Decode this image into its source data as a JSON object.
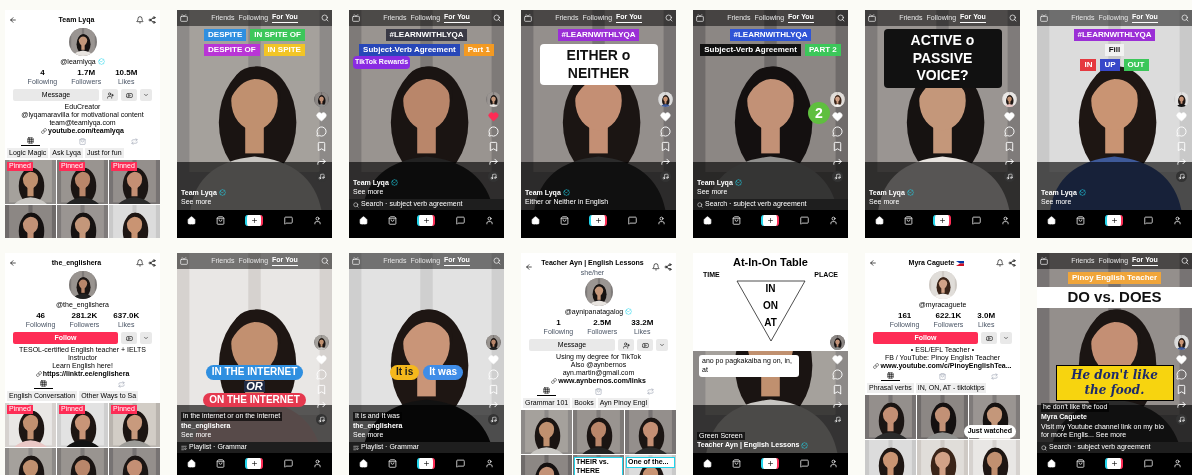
{
  "screens": [
    {
      "kind": "profile",
      "title": "Team Lyqa",
      "handle": "@learnlyqa",
      "verified": true,
      "stats": [
        {
          "value": "4",
          "label": "Following"
        },
        {
          "value": "1.7M",
          "label": "Followers"
        },
        {
          "value": "10.5M",
          "label": "Likes"
        }
      ],
      "button": {
        "label": "Message",
        "kind": "message"
      },
      "friend_button": true,
      "bio": [
        "EduCreator",
        "@lyqamaravilla for motivational content",
        "team@teamlyqa.com"
      ],
      "link": "youtube.com/teamlyqa",
      "content_tabs": [
        {
          "kind": "videos",
          "selected": true
        },
        {
          "kind": "shop",
          "selected": false
        },
        {
          "kind": "reposts",
          "selected": false
        }
      ],
      "playlists": [
        "Logic Magic",
        "Ask Lyqa",
        "Just for fun"
      ],
      "thumbnails": [
        {
          "kind": "picture",
          "badge": "Pinned"
        },
        {
          "kind": "picture",
          "badge": "Pinned"
        },
        {
          "kind": "picture",
          "badge": "Pinned"
        },
        {
          "kind": "picture"
        },
        {
          "kind": "picture"
        },
        {
          "kind": "picture"
        }
      ]
    },
    {
      "kind": "video",
      "tabs": [
        {
          "label": "Friends",
          "selected": false
        },
        {
          "label": "Following",
          "selected": false
        },
        {
          "label": "For You",
          "selected": true
        }
      ],
      "captions": [
        [
          {
            "kind": "tag",
            "text": "DESPITE",
            "color": "#2f8fe0"
          },
          {
            "kind": "tag",
            "text": "IN SPITE OF",
            "color": "#3cc75a"
          }
        ],
        [
          {
            "kind": "tag",
            "text": "DESPITE OF",
            "color": "#b935d6"
          },
          {
            "kind": "tag",
            "text": "IN SPITE",
            "color": "#f2c526"
          }
        ]
      ],
      "liked": false,
      "author": "Team Lyqa",
      "verified": true,
      "description": "See more"
    },
    {
      "kind": "video",
      "tabs": [
        {
          "label": "Friends",
          "selected": false
        },
        {
          "label": "Following",
          "selected": false
        },
        {
          "label": "For You",
          "selected": true
        }
      ],
      "captions": [
        [
          {
            "kind": "hashtag",
            "text": "#LEARNWITHLYQA",
            "color": "#3a3a46"
          }
        ],
        [
          {
            "kind": "tag",
            "text": "Subject-Verb Agreement",
            "color": "#2747b8"
          },
          {
            "kind": "tag",
            "text": "Part 1",
            "color": "#f39a23"
          }
        ]
      ],
      "badge": "TikTok Rewards",
      "liked": true,
      "author": "Team Lyqa",
      "verified": true,
      "description": "See more",
      "search": "Search · subject verb agreement"
    },
    {
      "kind": "video",
      "tabs": [
        {
          "label": "Friends",
          "selected": false
        },
        {
          "label": "Following",
          "selected": false
        },
        {
          "label": "For You",
          "selected": true
        }
      ],
      "captions": [
        [
          {
            "kind": "hashtag",
            "text": "#LEARNWITHLYQA",
            "color": "#9b2fd6"
          }
        ],
        [
          {
            "kind": "title",
            "text": "EITHER o NEITHER",
            "color": "#ffffff"
          }
        ]
      ],
      "liked": false,
      "author": "Team Lyqa",
      "verified": true,
      "description": "Either or Neither in English"
    },
    {
      "kind": "video",
      "tabs": [
        {
          "label": "Friends",
          "selected": false
        },
        {
          "label": "Following",
          "selected": false
        },
        {
          "label": "For You",
          "selected": true
        }
      ],
      "captions": [
        [
          {
            "kind": "hashtag",
            "text": "#LEARNWITHLYQA",
            "color": "#2f55d6"
          }
        ],
        [
          {
            "kind": "tag",
            "text": "Subject-Verb Agreement",
            "color": "#111111"
          },
          {
            "kind": "tag",
            "text": "PART 2",
            "color": "#3cc75a"
          }
        ]
      ],
      "sticker": "2",
      "liked": false,
      "author": "Team Lyqa",
      "verified": true,
      "description": "See more",
      "search": "Search · subject verb agreement"
    },
    {
      "kind": "video",
      "tabs": [
        {
          "label": "Friends",
          "selected": false
        },
        {
          "label": "Following",
          "selected": false
        },
        {
          "label": "For You",
          "selected": true
        }
      ],
      "captions": [
        [
          {
            "kind": "title",
            "text": "ACTIVE o PASSIVE VOICE?",
            "color": "#111111"
          }
        ]
      ],
      "liked": false,
      "author": "Team Lyqa",
      "verified": true,
      "description": "See more"
    },
    {
      "kind": "video",
      "tabs": [
        {
          "label": "Friends",
          "selected": false
        },
        {
          "label": "Following",
          "selected": false
        },
        {
          "label": "For You",
          "selected": true
        }
      ],
      "captions": [
        [
          {
            "kind": "hashtag",
            "text": "#LEARNWITHLYQA",
            "color": "#9b2fd6"
          }
        ],
        [
          {
            "kind": "tag",
            "text": "Fill",
            "color": "#f2f2f2"
          }
        ],
        [
          {
            "kind": "tag",
            "text": "IN",
            "color": "#e5393f"
          },
          {
            "kind": "tag",
            "text": "UP",
            "color": "#3747c9"
          },
          {
            "kind": "tag",
            "text": "OUT",
            "color": "#3cc75a"
          }
        ]
      ],
      "liked": false,
      "author": "Team Lyqa",
      "verified": true,
      "description": "See more"
    },
    {
      "kind": "profile",
      "title": "the_englishera",
      "handle": "@the_englishera",
      "verified": false,
      "stats": [
        {
          "value": "46",
          "label": "Following"
        },
        {
          "value": "281.2K",
          "label": "Followers"
        },
        {
          "value": "637.0K",
          "label": "Likes"
        }
      ],
      "button": {
        "label": "Follow",
        "kind": "follow"
      },
      "friend_button": false,
      "bio": [
        "TESOL-certified English teacher + IELTS Instructor",
        "Learn English here!"
      ],
      "link": "https://linktr.ee/englishera",
      "content_tabs": [
        {
          "kind": "videos",
          "selected": true
        },
        {
          "kind": "reposts",
          "selected": false
        }
      ],
      "playlists": [
        "English Conversation",
        "Other Ways to Sa"
      ],
      "thumbnails": [
        {
          "kind": "picture",
          "badge": "Pinned"
        },
        {
          "kind": "picture",
          "badge": "Pinned"
        },
        {
          "kind": "picture",
          "badge": "Pinned"
        },
        {
          "kind": "picture"
        },
        {
          "kind": "picture"
        },
        {
          "kind": "picture"
        }
      ]
    },
    {
      "kind": "video",
      "tabs": [
        {
          "label": "Friends",
          "selected": false
        },
        {
          "label": "Following",
          "selected": false
        },
        {
          "label": "For You",
          "selected": true
        }
      ],
      "lower_captions": [
        [
          {
            "kind": "pill",
            "text": "IN THE INTERNET",
            "color": "#2f8fe0"
          }
        ],
        [
          {
            "kind": "plain",
            "text": "OR"
          }
        ],
        [
          {
            "kind": "pill",
            "text": "ON THE INTERNET",
            "color": "#e5394f"
          }
        ]
      ],
      "caption_line": "in the internet or on the internet",
      "liked": false,
      "author": "the_englishera",
      "verified": false,
      "description": "See more",
      "playlist": "Playlist · Grammar"
    },
    {
      "kind": "video",
      "tabs": [
        {
          "label": "Friends",
          "selected": false
        },
        {
          "label": "Following",
          "selected": false
        },
        {
          "label": "For You",
          "selected": true
        }
      ],
      "lower_captions": [
        [
          {
            "kind": "pill",
            "text": "It is",
            "color": "#f5b81c"
          },
          {
            "kind": "pill",
            "text": "It was",
            "color": "#3f8de8"
          }
        ]
      ],
      "caption_line": "It is and It was",
      "liked": false,
      "author": "the_englishera",
      "verified": false,
      "description": "See more",
      "playlist": "Playlist · Grammar"
    },
    {
      "kind": "profile",
      "title": "Teacher Ayn | English Lessons",
      "subtitle": "she/her",
      "handle": "@aynipanatagalog",
      "verified": true,
      "stats": [
        {
          "value": "1",
          "label": "Following"
        },
        {
          "value": "2.5M",
          "label": "Followers"
        },
        {
          "value": "33.2M",
          "label": "Likes"
        }
      ],
      "button": {
        "label": "Message",
        "kind": "message"
      },
      "friend_button": true,
      "bio": [
        "Using my degree for TikTok",
        "Also @aynbernos",
        "ayn.martin@gmail.com"
      ],
      "link": "www.aynbernos.com/links",
      "content_tabs": [
        {
          "kind": "videos",
          "selected": true
        },
        {
          "kind": "shop",
          "selected": false
        },
        {
          "kind": "reposts",
          "selected": false
        }
      ],
      "playlists": [
        "Grammar 101",
        "Books",
        "Ayn Pinoy Engl"
      ],
      "thumbnails": [
        {
          "kind": "picture"
        },
        {
          "kind": "picture"
        },
        {
          "kind": "picture"
        },
        {
          "kind": "picture"
        },
        {
          "kind": "picture",
          "label": "THEIR vs. THERE"
        },
        {
          "kind": "picture",
          "label": "One of the..."
        }
      ]
    },
    {
      "kind": "video",
      "board": {
        "title": "At-In-On Table",
        "left": "TIME",
        "right": "PLACE",
        "levels": [
          "IN",
          "ON",
          "AT"
        ]
      },
      "comment": "ano po pagkakaiba ng on, in, at",
      "liked": false,
      "effect": "Green Screen",
      "author": "Teacher Ayn | English Lessons",
      "verified": true
    },
    {
      "kind": "profile",
      "title": "Myra Caguete",
      "flag": true,
      "handle": "@myracaguete",
      "verified": false,
      "stats": [
        {
          "value": "161",
          "label": "Following"
        },
        {
          "value": "622.1K",
          "label": "Followers"
        },
        {
          "value": "3.0M",
          "label": "Likes"
        }
      ],
      "button": {
        "label": "Follow",
        "kind": "follow"
      },
      "friend_button": false,
      "bio": [
        "• ESL/EFL Teacher •",
        "FB / YouTube: Pinoy English Teacher"
      ],
      "link": "www.youtube.com/c/PinoyEnglishTea...",
      "content_tabs": [
        {
          "kind": "videos",
          "selected": true
        },
        {
          "kind": "shop",
          "selected": false
        },
        {
          "kind": "reposts",
          "selected": false
        }
      ],
      "playlists": [
        "Phrasal verbs",
        "IN, ON, AT - tiktoktips"
      ],
      "thumbnails": [
        {
          "kind": "picture"
        },
        {
          "kind": "picture"
        },
        {
          "kind": "picture"
        },
        {
          "kind": "picture"
        },
        {
          "kind": "picture"
        },
        {
          "kind": "picture"
        }
      ],
      "overlay_button": "Just watched"
    },
    {
      "kind": "video",
      "tabs": [
        {
          "label": "Friends",
          "selected": false
        },
        {
          "label": "Following",
          "selected": false
        },
        {
          "label": "For You",
          "selected": true
        }
      ],
      "captions": [
        [
          {
            "kind": "hashtag",
            "text": "Pinoy English Teacher",
            "color": "#f0a53a"
          }
        ],
        [
          {
            "kind": "banner",
            "text": "DO vs. DOES",
            "color": "#ffffff"
          }
        ]
      ],
      "lower_captions": [
        [
          {
            "kind": "quote",
            "text": "He don't like the food.",
            "color": "#f7d40f"
          }
        ]
      ],
      "caption_line": "he don't like the food",
      "liked": false,
      "author": "Myra Caguete",
      "verified": false,
      "description": "Visit my Youtube channel link on my bio for more Englis... See more",
      "search": "Search · subject verb agreement"
    }
  ]
}
